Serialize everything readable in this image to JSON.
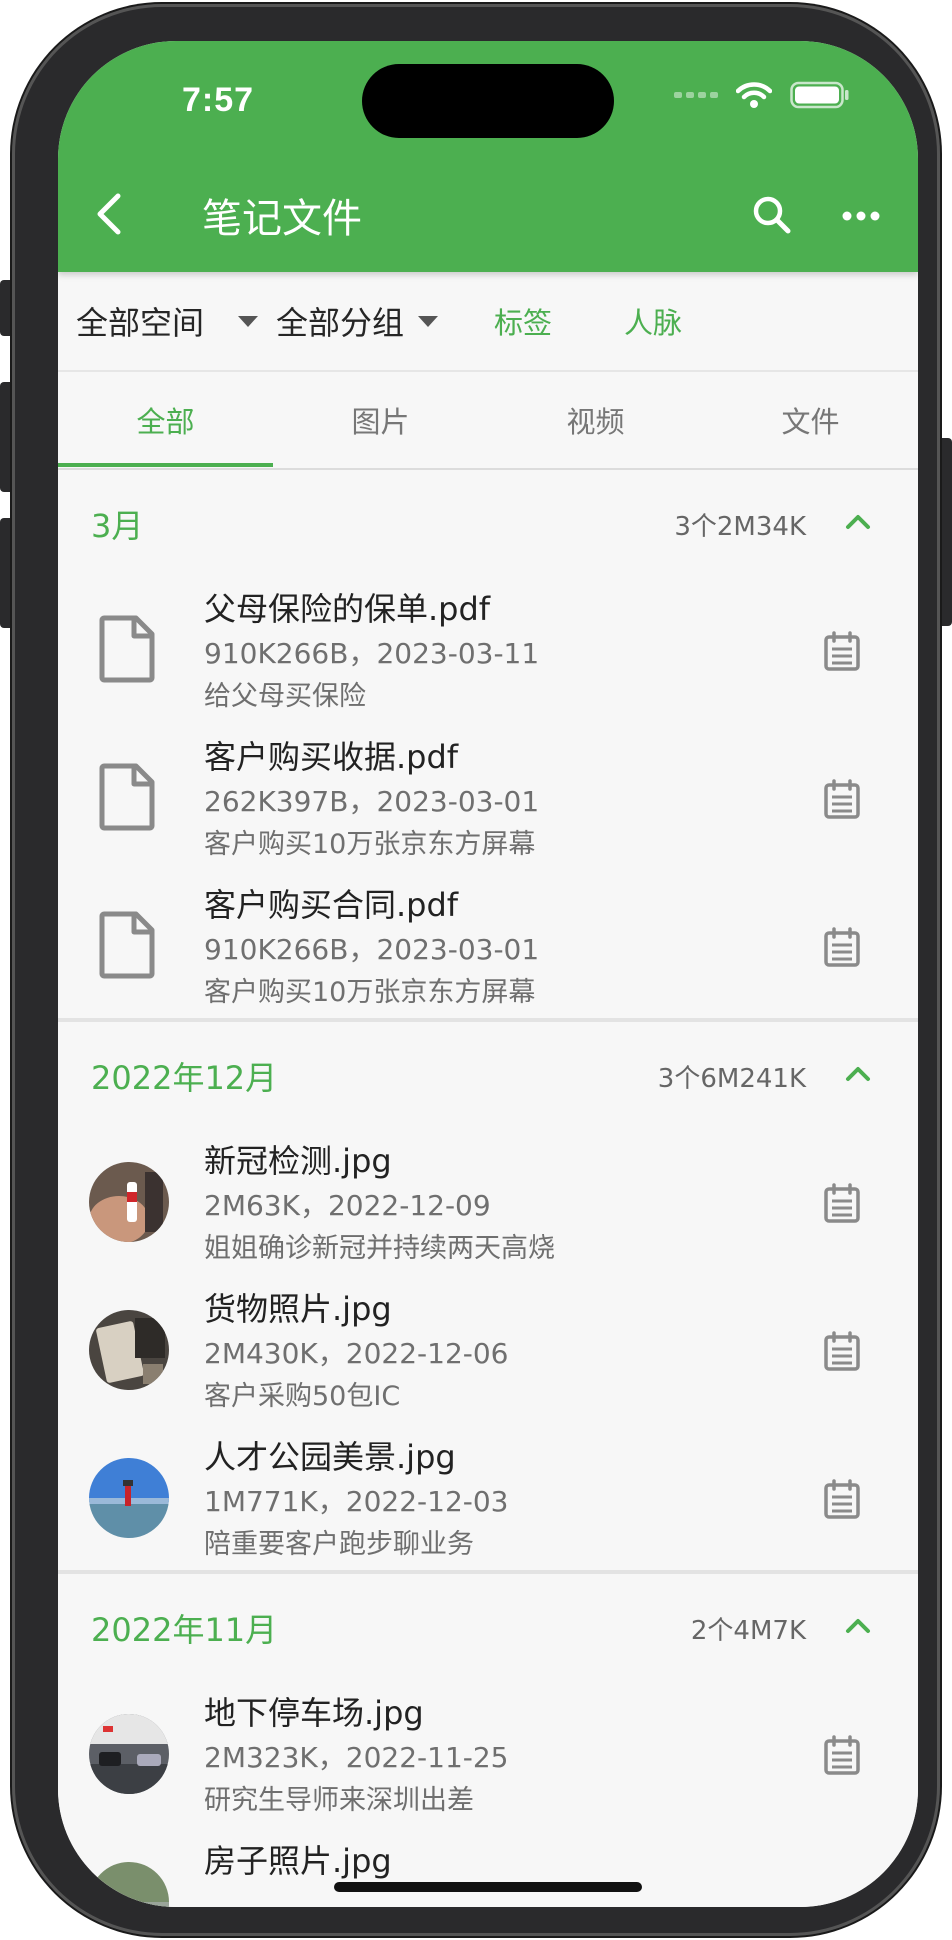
{
  "status_bar": {
    "time": "7:57"
  },
  "header": {
    "title": "笔记文件"
  },
  "filters": [
    {
      "label": "全部空间"
    },
    {
      "label": "全部分组"
    },
    {
      "label": "标签"
    },
    {
      "label": "人脉"
    }
  ],
  "tabs": [
    {
      "label": "全部",
      "active": true
    },
    {
      "label": "图片"
    },
    {
      "label": "视频"
    },
    {
      "label": "文件"
    }
  ],
  "groups": [
    {
      "title": "3月",
      "summary": "3个2M34K",
      "files": [
        {
          "name": "父母保险的保单.pdf",
          "meta": "910K266B，2023-03-11",
          "note": "给父母买保险",
          "type": "pdf"
        },
        {
          "name": "客户购买收据.pdf",
          "meta": "262K397B，2023-03-01",
          "note": "客户购买10万张京东方屏幕",
          "type": "pdf"
        },
        {
          "name": "客户购买合同.pdf",
          "meta": "910K266B，2023-03-01",
          "note": "客户购买10万张京东方屏幕",
          "type": "pdf"
        }
      ]
    },
    {
      "title": "2022年12月",
      "summary": "3个6M241K",
      "files": [
        {
          "name": "新冠检测.jpg",
          "meta": "2M63K，2022-12-09",
          "note": "姐姐确诊新冠并持续两天高烧",
          "type": "image"
        },
        {
          "name": "货物照片.jpg",
          "meta": "2M430K，2022-12-06",
          "note": "客户采购50包IC",
          "type": "image"
        },
        {
          "name": "人才公园美景.jpg",
          "meta": "1M771K，2022-12-03",
          "note": "陪重要客户跑步聊业务",
          "type": "image"
        }
      ]
    },
    {
      "title": "2022年11月",
      "summary": "2个4M7K",
      "files": [
        {
          "name": "地下停车场.jpg",
          "meta": "2M323K，2022-11-25",
          "note": "研究生导师来深圳出差",
          "type": "image"
        },
        {
          "name": "房子照片.jpg",
          "meta": "",
          "note": "",
          "type": "image"
        }
      ]
    }
  ]
}
